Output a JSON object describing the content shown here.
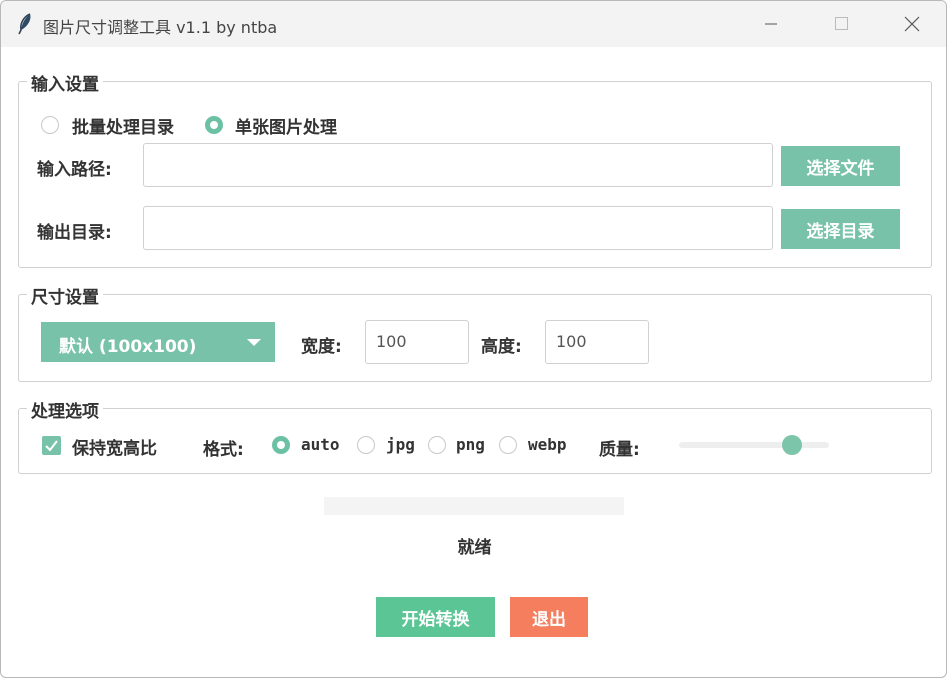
{
  "window": {
    "title": "图片尺寸调整工具 v1.1 by ntba"
  },
  "input_group": {
    "label": "输入设置",
    "mode_batch": "批量处理目录",
    "mode_single": "单张图片处理",
    "selected_mode": "单张图片处理",
    "input_path_label": "输入路径:",
    "input_path_value": "",
    "select_file": "选择文件",
    "output_dir_label": "输出目录:",
    "output_dir_value": "",
    "select_dir": "选择目录"
  },
  "size_group": {
    "label": "尺寸设置",
    "preset": "默认 (100x100)",
    "width_label": "宽度:",
    "width_value": "100",
    "height_label": "高度:",
    "height_value": "100"
  },
  "options_group": {
    "label": "处理选项",
    "keep_ratio": "保持宽高比",
    "keep_ratio_checked": true,
    "format_label": "格式:",
    "formats": [
      "auto",
      "jpg",
      "png",
      "webp"
    ],
    "selected_format": "auto",
    "quality_label": "质量:",
    "quality_fraction": 0.75
  },
  "progress": {
    "fraction": 0
  },
  "status": "就绪",
  "actions": {
    "start": "开始转换",
    "exit": "退出"
  },
  "colors": {
    "accent": "#78c2a9",
    "start": "#5cc595",
    "exit": "#f47e5e"
  },
  "icons": {
    "app": "feather-icon",
    "minimize": "minimize-icon",
    "maximize": "maximize-icon",
    "close": "close-icon"
  }
}
